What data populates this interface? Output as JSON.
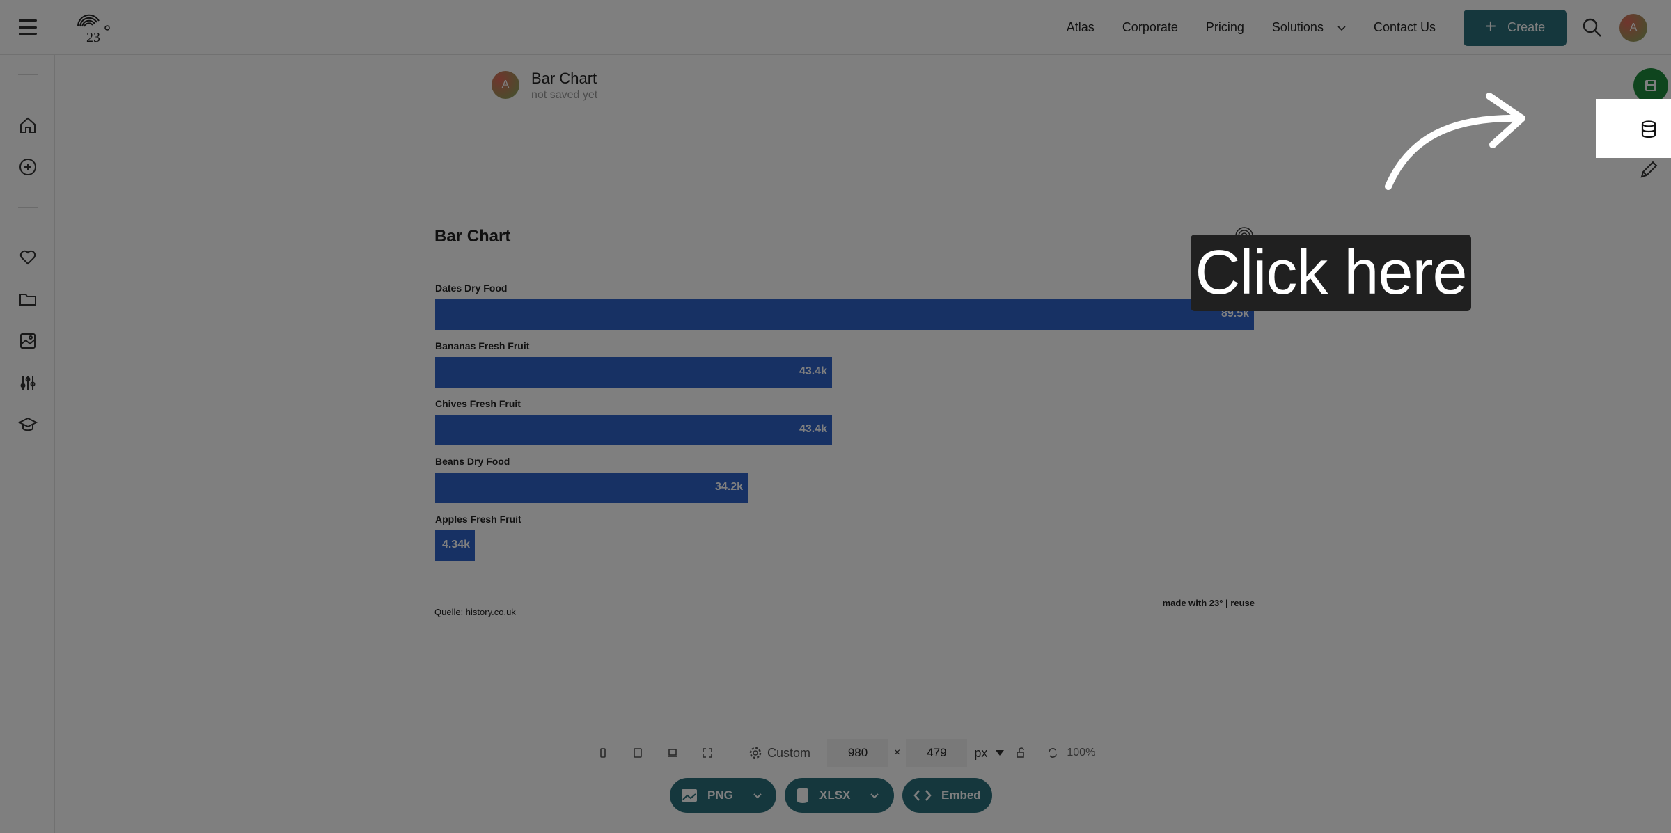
{
  "header": {
    "nav": [
      "Atlas",
      "Corporate",
      "Pricing",
      "Solutions",
      "Contact Us"
    ],
    "create_label": "Create",
    "avatar_initial": "A"
  },
  "document": {
    "title": "Bar Chart",
    "status": "not saved yet",
    "avatar_initial": "A"
  },
  "chart_data": {
    "type": "bar",
    "orientation": "horizontal",
    "title": "Bar Chart",
    "categories": [
      "Dates Dry Food",
      "Bananas Fresh Fruit",
      "Chives Fresh Fruit",
      "Beans Dry Food",
      "Apples Fresh Fruit"
    ],
    "values": [
      89500,
      43400,
      43400,
      34200,
      4340
    ],
    "value_labels": [
      "89.5k",
      "43.4k",
      "43.4k",
      "34.2k",
      "4.34k"
    ],
    "bar_color": "#2f63c9",
    "source": "Quelle: history.co.uk",
    "credit": "made with 23° | reuse"
  },
  "toolbar": {
    "preset": "Custom",
    "width": "980",
    "height": "479",
    "unit": "px",
    "zoom": "100%"
  },
  "downloads": {
    "png": "PNG",
    "xlsx": "XLSX",
    "embed": "Embed"
  },
  "overlay": {
    "callout": "Click here",
    "dim_opacity": 0.5
  },
  "colors": {
    "brand_teal": "#2a6f7a",
    "save_green": "#1e8a3c",
    "bar_blue": "#2f63c9"
  },
  "icons": {
    "sidebar": [
      "home-icon",
      "add-circle-icon",
      "heart-icon",
      "folder-icon",
      "image-icon",
      "sliders-icon",
      "graduation-cap-icon"
    ],
    "right_column": [
      "save-icon",
      "database-icon",
      "pencil-icon"
    ]
  }
}
